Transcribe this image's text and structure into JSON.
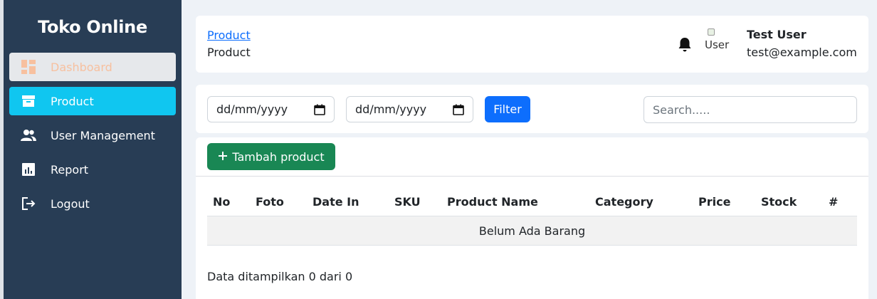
{
  "sidebar": {
    "brand": "Toko Online",
    "items": [
      {
        "label": "Dashboard",
        "icon": "dashboard-icon"
      },
      {
        "label": "Product",
        "icon": "archive-box-icon"
      },
      {
        "label": "User Management",
        "icon": "users-icon"
      },
      {
        "label": "Report",
        "icon": "chart-report-icon"
      },
      {
        "label": "Logout",
        "icon": "logout-icon"
      }
    ]
  },
  "header": {
    "breadcrumb_link": "Product",
    "breadcrumb_current": "Product",
    "avatar_alt": "User",
    "user_name": "Test User",
    "user_email": "test@example.com"
  },
  "filter": {
    "date_from": "dd/mm/yyyy",
    "date_to": "dd/mm/yyyy",
    "filter_label": "Filter",
    "search_placeholder": "Search....."
  },
  "table": {
    "add_button_label": "Tambah product",
    "columns": [
      "No",
      "Foto",
      "Date In",
      "SKU",
      "Product Name",
      "Category",
      "Price",
      "Stock",
      "#"
    ],
    "empty_message": "Belum Ada Barang",
    "footer": "Data ditampilkan 0 dari 0"
  },
  "colors": {
    "sidebar_bg": "#283d55",
    "active_item": "#10c6f0",
    "primary": "#0d6efd",
    "success": "#198754"
  }
}
